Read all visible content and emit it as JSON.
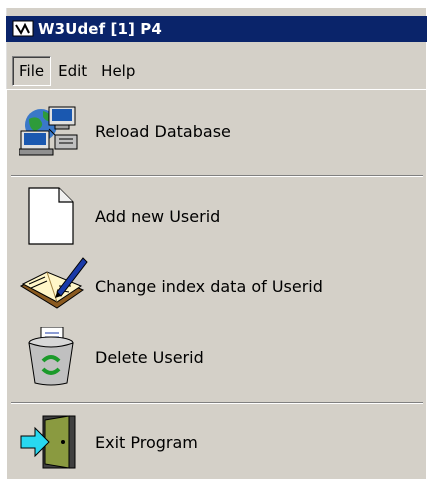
{
  "window": {
    "title": "W3Udef [1] P4"
  },
  "menubar": {
    "items": [
      "File",
      "Edit",
      "Help"
    ]
  },
  "file_menu": {
    "items": [
      {
        "label": "Reload Database",
        "icon": "network-computers-icon"
      },
      {
        "label": "Add new Userid",
        "icon": "blank-document-icon"
      },
      {
        "label": "Change index data of Userid",
        "icon": "book-pen-icon"
      },
      {
        "label": "Delete Userid",
        "icon": "recycle-bin-icon"
      },
      {
        "label": "Exit Program",
        "icon": "exit-door-icon"
      }
    ]
  },
  "colors": {
    "titlebar": "#0a246a",
    "face": "#d4d0c8"
  }
}
